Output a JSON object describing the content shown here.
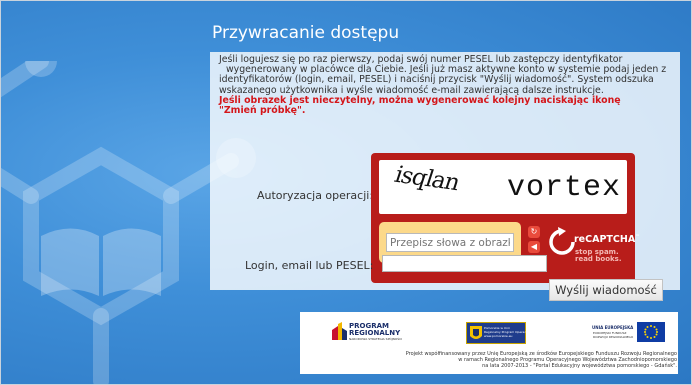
{
  "page": {
    "title": "Przywracanie dostępu",
    "info_lines": [
      "Jeśli logujesz się po raz pierwszy, podaj swój numer PESEL lub zastępczy identyfikator",
      "wygenerowany w placówce dla Ciebie. Jeśli już masz aktywne konto w systemie podaj jeden z",
      "identyfikatorów (login, email, PESEL) i naciśnij przycisk \"Wyślij wiadomość\". System odszuka",
      "wskazanego użytkownika i wyśle wiadomość e-mail zawierającą dalsze instrukcje."
    ],
    "warning_lines": [
      "Jeśli obrazek jest nieczytelny, można wygenerować kolejny naciskając ikonę",
      "\"Zmień próbkę\"."
    ]
  },
  "captcha": {
    "label": "Autoryzacja operacji:",
    "word1": "isqlan",
    "word2": "vortex",
    "placeholder": "Przepisz słowa z obrazka",
    "brand": "reCAPTCHA",
    "brand_tm": "™",
    "tagline1": "stop spam.",
    "tagline2": "read books.",
    "reload_icon": "reload-icon",
    "audio_icon": "audio-icon",
    "help_icon": "help-icon",
    "accent": "#b81d1a"
  },
  "login": {
    "label": "Login, email lub PESEL:",
    "value": ""
  },
  "send_button": "Wyślij wiadomość",
  "footer": {
    "program_title1": "PROGRAM",
    "program_title2": "REGIONALNY",
    "program_sub": "NARODOWA STRATEGIA SPÓJNOŚCI",
    "pomorskie_text1": "Pomorskie w Unii",
    "pomorskie_text2": "Regionalny Program Operacyjny",
    "pomorskie_text3": "www.pomorskie.eu",
    "ue_title": "UNIA EUROPEJSKA",
    "ue_sub1": "EUROPEJSKI FUNDUSZ",
    "ue_sub2": "ROZWOJU REGIONALNEGO",
    "text_lines": [
      "Projekt współfinansowany przez Unię Europejską ze środków Europejskiego Funduszu Rozwoju Regionalnego",
      "w ramach Regionalnego Programu Operacyjnego Województwa Zachodniopomorskiego",
      "na lata 2007-2013 - \"Portal Edukacyjny województwa pomorskiego - Gdańsk\"."
    ]
  }
}
